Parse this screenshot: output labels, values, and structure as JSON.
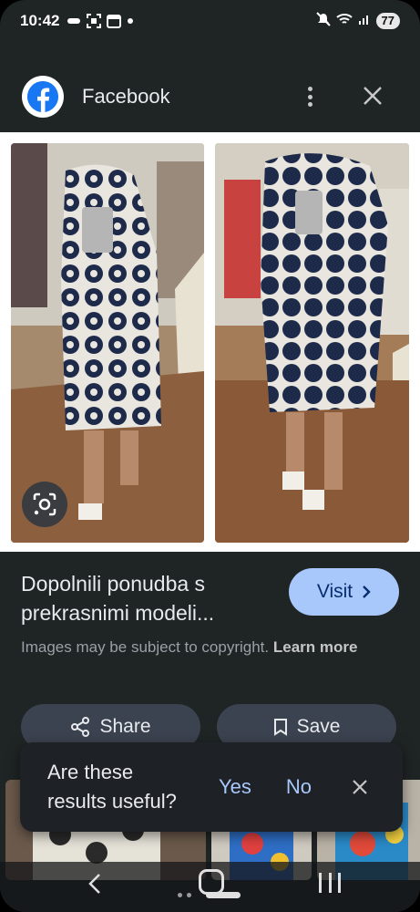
{
  "status_bar": {
    "time": "10:42",
    "battery": "77"
  },
  "header": {
    "site_name": "Facebook"
  },
  "result": {
    "title_line1": "Dopolnili ponudba s",
    "title_line2": "prekrasnimi modeli...",
    "visit_label": "Visit",
    "copyright_text": "Images may be subject to copyright.",
    "learn_more": "Learn more",
    "share_label": "Share",
    "save_label": "Save"
  },
  "feedback": {
    "question_line1": "Are these",
    "question_line2": "results useful?",
    "yes": "Yes",
    "no": "No"
  },
  "colors": {
    "background": "#1f2424",
    "accent": "#a8c7fa",
    "facebook_blue": "#1877f2",
    "button_bg": "#3c4350",
    "dress_navy": "#1e2a4a"
  }
}
